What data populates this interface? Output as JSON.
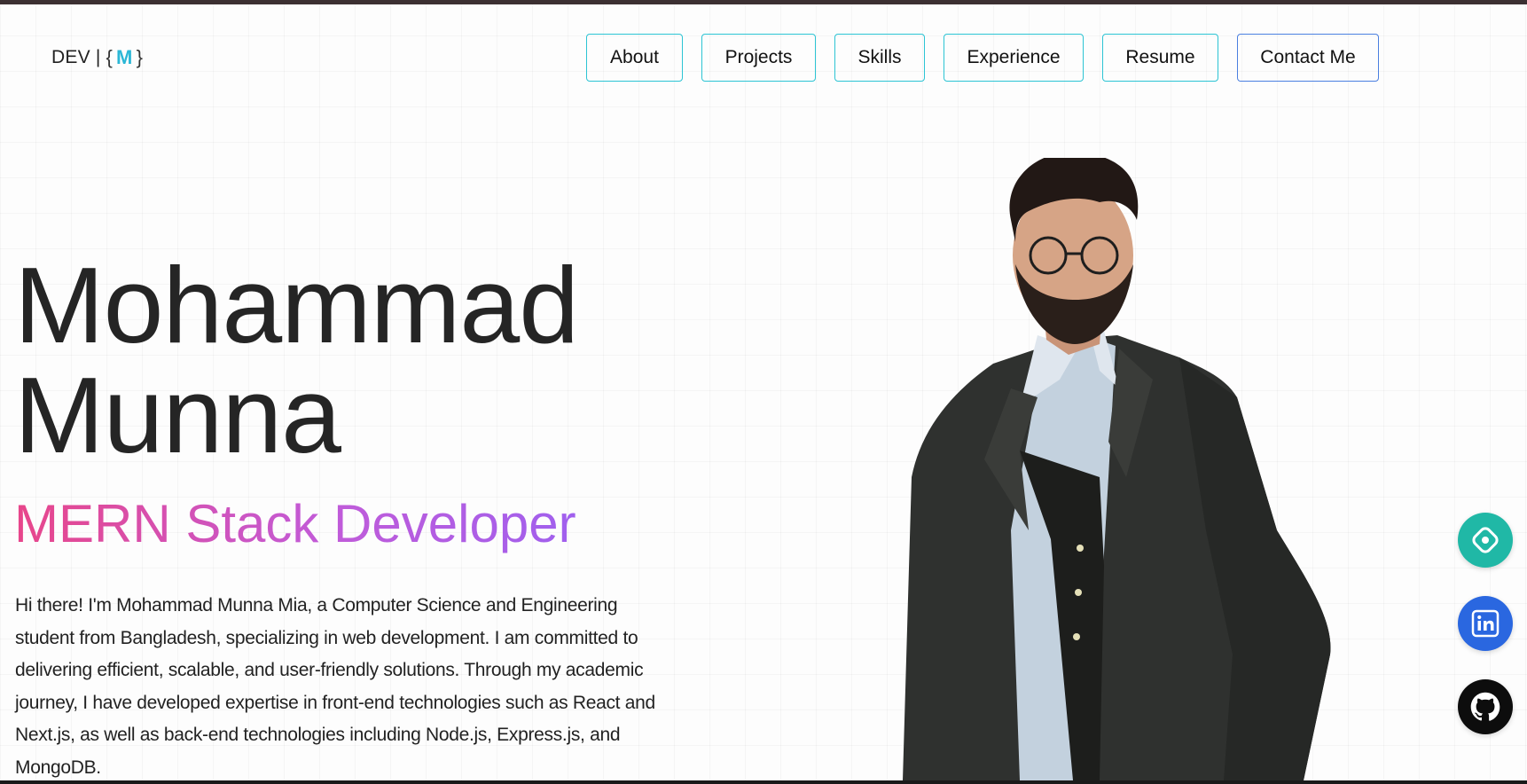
{
  "logo": {
    "prefix": "DEV |",
    "open_brace": "{",
    "mark": "M",
    "close_brace": "}"
  },
  "nav": {
    "items": [
      {
        "label": "About"
      },
      {
        "label": "Projects"
      },
      {
        "label": "Skills"
      },
      {
        "label": "Experience"
      },
      {
        "label": "Resume"
      },
      {
        "label": "Contact Me"
      }
    ]
  },
  "hero": {
    "first_name": "Mohammad",
    "last_name": "Munna",
    "role": "MERN Stack Developer",
    "bio": "Hi there! I'm Mohammad Munna Mia, a Computer Science and Engineering student from Bangladesh, specializing in web development. I am committed to delivering efficient, scalable, and user-friendly solutions. Through my academic journey, I have developed expertise in front-end technologies such as React and Next.js, as well as back-end technologies including Node.js, Express.js, and MongoDB."
  },
  "social": [
    {
      "icon": "hashnode-icon",
      "color": "#20b8a6"
    },
    {
      "icon": "linkedin-icon",
      "color": "#2a67e0"
    },
    {
      "icon": "github-icon",
      "color": "#0d0d0d"
    }
  ],
  "colors": {
    "nav_border": "#2cc4d4",
    "contact_border": "#4a7fe0",
    "role_gradient_start": "#e8468a",
    "role_gradient_end": "#a060ee"
  }
}
